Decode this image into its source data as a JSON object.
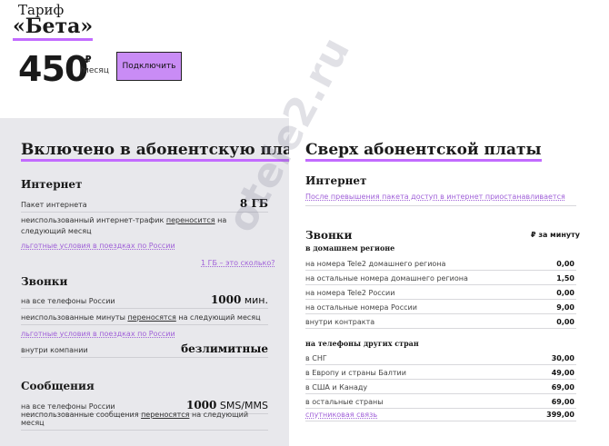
{
  "header": {
    "tariff_label": "Тариф",
    "tariff_name": "«Бета»",
    "price": "450",
    "currency": "₽",
    "period": "/месяц",
    "connect_button": "Подключить"
  },
  "included": {
    "title": "Включено в абонентскую плату",
    "internet": {
      "title": "Интернет",
      "package_label": "Пакет интернета",
      "package_value": "8 ГБ",
      "rollover_prefix": "неиспользованный интернет-трафик ",
      "rollover_link": "переносится",
      "rollover_suffix": " на следующий месяц",
      "travel_link": "льготные условия в поездках по России",
      "gb_link": "1 ГБ – это сколько?"
    },
    "calls": {
      "title": "Звонки",
      "all_russia_label": "на все телефоны России",
      "all_russia_value": "1000",
      "all_russia_unit": " мин.",
      "rollover_prefix": "неиспользованные минуты ",
      "rollover_link": "переносятся",
      "rollover_suffix": " на следующий месяц",
      "travel_link": "льготные условия в поездках по России",
      "company_label": "внутри компании",
      "company_value": "безлимитные"
    },
    "messages": {
      "title": "Сообщения",
      "all_russia_label": "на все телефоны России",
      "all_russia_value": "1000",
      "all_russia_unit": " SMS/MMS",
      "rollover_prefix": "неиспользованные сообщения ",
      "rollover_link": "переносятся",
      "rollover_suffix": " на следующий месяц"
    }
  },
  "extra": {
    "title": "Сверх абонентской платы",
    "internet": {
      "title": "Интернет",
      "note_link": "После превышения пакета доступ в интернет приостанавливается"
    },
    "calls": {
      "title": "Звонки",
      "unit_header": "₽ за минуту",
      "home_region_title": "в домашнем регионе",
      "home_region_rows": [
        {
          "label": "на номера Tele2 домашнего региона",
          "value": "0,00"
        },
        {
          "label": "на остальные номера домашнего региона",
          "value": "1,50"
        },
        {
          "label": "на номера Tele2 России",
          "value": "0,00"
        },
        {
          "label": "на остальные номера России",
          "value": "9,00"
        },
        {
          "label": "внутри контракта",
          "value": "0,00"
        }
      ],
      "foreign_title": "на телефоны других стран",
      "foreign_rows": [
        {
          "label": "в СНГ",
          "value": "30,00"
        },
        {
          "label": "в Европу и страны Балтии",
          "value": "49,00"
        },
        {
          "label": "в США и Канаду",
          "value": "69,00"
        },
        {
          "label": "в остальные страны",
          "value": "69,00"
        }
      ],
      "satellite_link": "спутниковая связь",
      "satellite_value": "399,00"
    }
  },
  "watermark": "otele2.ru",
  "colors": {
    "accent": "#c26bff",
    "button": "#c98cf5",
    "link": "#a061d8",
    "panel": "#e8e8ec"
  }
}
